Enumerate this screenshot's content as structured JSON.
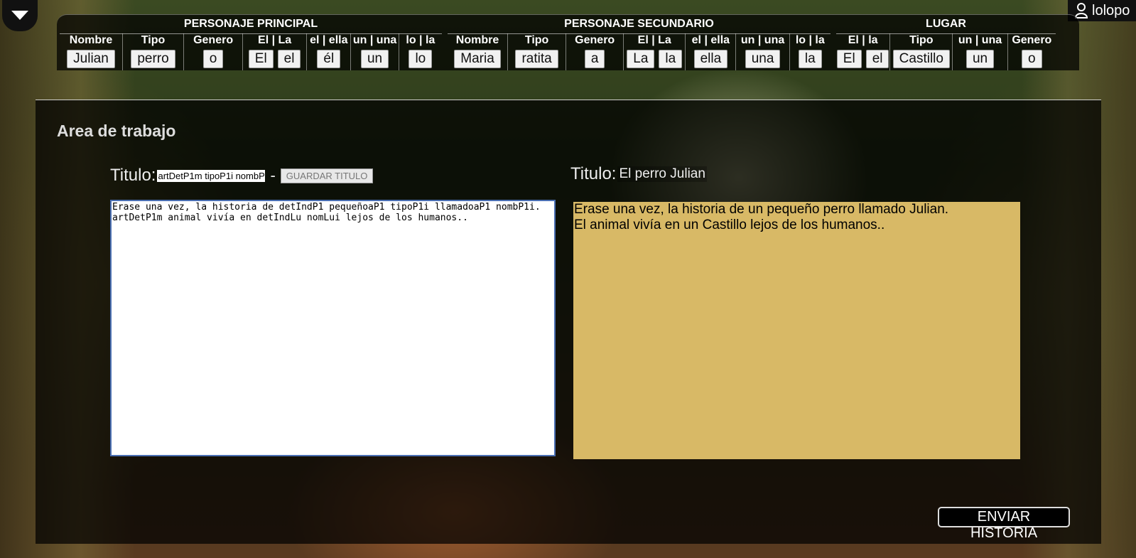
{
  "user": {
    "name": "lolopo"
  },
  "personaje_principal": {
    "title": "PERSONAJE PRINCIPAL",
    "columns": [
      {
        "header": "Nombre",
        "values": [
          "Julian"
        ]
      },
      {
        "header": "Tipo",
        "values": [
          "perro"
        ]
      },
      {
        "header": "Genero",
        "values": [
          "o"
        ]
      },
      {
        "header": "El | La",
        "values": [
          "El",
          "el"
        ]
      },
      {
        "header": "el | ella",
        "values": [
          "él"
        ]
      },
      {
        "header": "un | una",
        "values": [
          "un"
        ]
      },
      {
        "header": "lo | la",
        "values": [
          "lo"
        ]
      }
    ]
  },
  "personaje_secundario": {
    "title": "PERSONAJE SECUNDARIO",
    "columns": [
      {
        "header": "Nombre",
        "values": [
          "Maria"
        ]
      },
      {
        "header": "Tipo",
        "values": [
          "ratita"
        ]
      },
      {
        "header": "Genero",
        "values": [
          "a"
        ]
      },
      {
        "header": "El | La",
        "values": [
          "La",
          "la"
        ]
      },
      {
        "header": "el | ella",
        "values": [
          "ella"
        ]
      },
      {
        "header": "un | una",
        "values": [
          "una"
        ]
      },
      {
        "header": "lo | la",
        "values": [
          "la"
        ]
      }
    ]
  },
  "lugar": {
    "title": "LUGAR",
    "columns": [
      {
        "header": "El | la",
        "values": [
          "El",
          "el"
        ]
      },
      {
        "header": "Tipo",
        "values": [
          "Castillo"
        ]
      },
      {
        "header": "un | una",
        "values": [
          "un"
        ]
      },
      {
        "header": "Genero",
        "values": [
          "o"
        ]
      }
    ]
  },
  "workspace": {
    "heading": "Area de trabajo",
    "title_label": "Titulo:",
    "title_input_value": "artDetP1m tipoP1i nombP1i",
    "title_dash": "-",
    "save_title_button": "GUARDAR TITULO",
    "preview_title_label": "Titulo:",
    "preview_title_value": "El perro Julian",
    "editor_text": "Erase una vez, la historia de detIndP1 pequeñoaP1 tipoP1i llamadoaP1 nombP1i.\nartDetP1m animal vivía en detIndLu nomLui lejos de los humanos..",
    "preview_lines": [
      "Erase una vez, la historia de un pequeño perro llamado Julian.",
      "El animal vivía en un Castillo lejos de los humanos.."
    ],
    "send_button": "ENVIAR HISTORIA"
  }
}
